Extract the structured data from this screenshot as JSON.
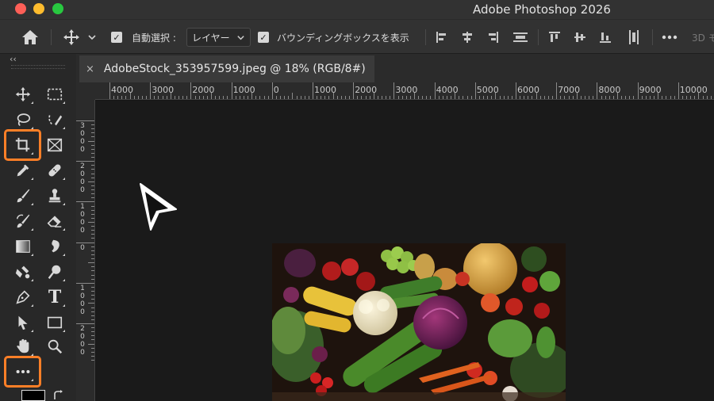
{
  "window": {
    "title": "Adobe Photoshop 2026"
  },
  "options_bar": {
    "auto_select_label": "自動選択 :",
    "auto_select_value": "レイヤー",
    "bounding_box_label": "バウンディングボックスを表示",
    "mode_3d_label": "3D モ"
  },
  "document": {
    "tab_title": "AdobeStock_353957599.jpeg @ 18% (RGB/8#)",
    "close_glyph": "×"
  },
  "ruler": {
    "h_labels": [
      "4000",
      "3000",
      "2000",
      "1000",
      "0",
      "1000",
      "2000",
      "3000",
      "4000",
      "5000",
      "6000",
      "7000",
      "8000",
      "9000",
      "10000"
    ],
    "v_labels": [
      "3000",
      "2000",
      "1000",
      "0",
      "1000",
      "2000"
    ]
  },
  "toolbar": {
    "collapse_glyph": "‹‹",
    "tools": [
      {
        "name": "move-tool",
        "icon": "move-icon"
      },
      {
        "name": "marquee-tool",
        "icon": "rectangle-marquee-icon"
      },
      {
        "name": "lasso-tool",
        "icon": "lasso-icon"
      },
      {
        "name": "object-selection-tool",
        "icon": "magic-selection-icon"
      },
      {
        "name": "crop-tool",
        "icon": "crop-icon",
        "highlighted": true
      },
      {
        "name": "frame-tool",
        "icon": "frame-icon"
      },
      {
        "name": "eyedropper-tool",
        "icon": "eyedropper-icon"
      },
      {
        "name": "healing-brush-tool",
        "icon": "bandage-icon"
      },
      {
        "name": "brush-tool",
        "icon": "brush-icon"
      },
      {
        "name": "clone-stamp-tool",
        "icon": "stamp-icon"
      },
      {
        "name": "history-brush-tool",
        "icon": "history-brush-icon"
      },
      {
        "name": "eraser-tool",
        "icon": "eraser-icon"
      },
      {
        "name": "gradient-tool",
        "icon": "gradient-icon"
      },
      {
        "name": "blur-tool",
        "icon": "drop-icon"
      },
      {
        "name": "dodge-tool",
        "icon": "dodge-icon"
      },
      {
        "name": "burn-tool",
        "icon": "magnify-icon"
      },
      {
        "name": "pen-tool",
        "icon": "pen-icon"
      },
      {
        "name": "type-tool",
        "icon": "type-icon",
        "glyph": "T"
      },
      {
        "name": "path-selection-tool",
        "icon": "arrow-icon"
      },
      {
        "name": "rectangle-tool",
        "icon": "rectangle-icon"
      },
      {
        "name": "hand-tool",
        "icon": "hand-icon"
      },
      {
        "name": "zoom-tool",
        "icon": "zoom-icon"
      },
      {
        "name": "edit-toolbar",
        "icon": "more-icon",
        "highlighted": true
      }
    ]
  },
  "colors": {
    "highlight": "#ff7f27",
    "panel": "#282828",
    "canvas": "#1a1a1a"
  }
}
